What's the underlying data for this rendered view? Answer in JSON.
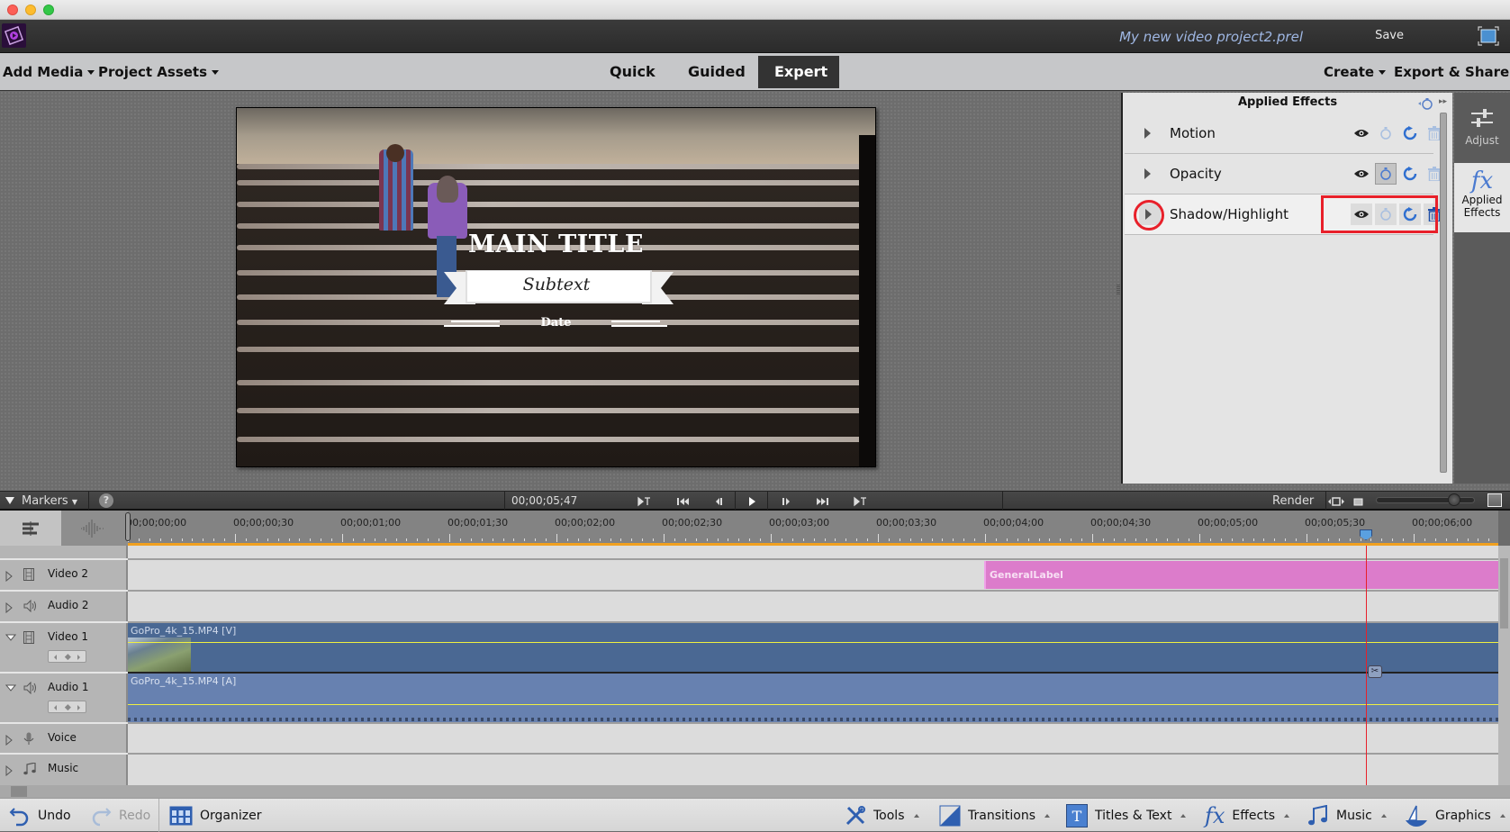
{
  "window": {
    "traffic_lights": [
      "close",
      "minimize",
      "zoom"
    ],
    "colors": {
      "close": "#fc5f57",
      "minimize": "#fdbc2e",
      "zoom": "#33c748"
    }
  },
  "appbar": {
    "project_name": "My new video project2.prel",
    "save_label": "Save"
  },
  "menubar": {
    "left": [
      {
        "label": "Add Media",
        "has_menu": true
      },
      {
        "label": "Project Assets",
        "has_menu": true
      }
    ],
    "modes": [
      {
        "label": "Quick",
        "active": false
      },
      {
        "label": "Guided",
        "active": false
      },
      {
        "label": "Expert",
        "active": true
      }
    ],
    "right": [
      {
        "label": "Create",
        "has_menu": true
      },
      {
        "label": "Export & Share",
        "has_menu": false
      }
    ]
  },
  "preview": {
    "main_title": "MAIN TITLE",
    "subtext": "Subtext",
    "date": "Date"
  },
  "applied_effects": {
    "title": "Applied Effects",
    "effects": [
      {
        "name": "Motion",
        "keyframe_active": false,
        "highlighted": false,
        "expand_marked": false
      },
      {
        "name": "Opacity",
        "keyframe_active": true,
        "highlighted": false,
        "expand_marked": false
      },
      {
        "name": "Shadow/Highlight",
        "keyframe_active": false,
        "highlighted": true,
        "expand_marked": true
      }
    ],
    "icons": [
      "eye-icon",
      "stopwatch-icon",
      "reset-icon",
      "trash-icon"
    ],
    "annotation_color": "#e8202a"
  },
  "side_tabs": [
    {
      "label": "Adjust",
      "active": false
    },
    {
      "label": "Applied Effects",
      "label_line1": "Applied",
      "label_line2": "Effects",
      "active": true
    }
  ],
  "timeline": {
    "markers_label": "Markers",
    "help_label": "?",
    "current_time": "00;00;05;47",
    "render_label": "Render",
    "zoom_level": 0.85,
    "ruler_labels": [
      "00;00;00;00",
      "00;00;00;30",
      "00;00;01;00",
      "00;00;01;30",
      "00;00;02;00",
      "00;00;02;30",
      "00;00;03;00",
      "00;00;03;30",
      "00;00;04;00",
      "00;00;04;30",
      "00;00;05;00",
      "00;00;05;30",
      "00;00;06;00"
    ],
    "playhead_time": "00;00;05;47",
    "tracks": [
      {
        "name": "Video 2",
        "type": "video",
        "expanded": false
      },
      {
        "name": "Audio 2",
        "type": "audio",
        "expanded": false
      },
      {
        "name": "Video 1",
        "type": "video",
        "expanded": true
      },
      {
        "name": "Audio 1",
        "type": "audio",
        "expanded": true
      },
      {
        "name": "Voice",
        "type": "voice",
        "expanded": false
      },
      {
        "name": "Music",
        "type": "music",
        "expanded": false
      }
    ],
    "clips": {
      "title_clip": {
        "label": "GeneralLabel",
        "track": "Video 2",
        "start_time": "00;00;04;00",
        "color": "#dc7ccb"
      },
      "video_clip": {
        "label": "GoPro_4k_15.MP4 [V]",
        "track": "Video 1",
        "color": "#4a6893"
      },
      "audio_clip": {
        "label": "GoPro_4k_15.MP4 [A]",
        "track": "Audio 1",
        "color": "#6781b0"
      }
    }
  },
  "bottombar": {
    "undo_label": "Undo",
    "redo_label": "Redo",
    "organizer_label": "Organizer",
    "tools_label": "Tools",
    "transitions_label": "Transitions",
    "titles_label": "Titles & Text",
    "effects_label": "Effects",
    "music_label": "Music",
    "graphics_label": "Graphics"
  }
}
